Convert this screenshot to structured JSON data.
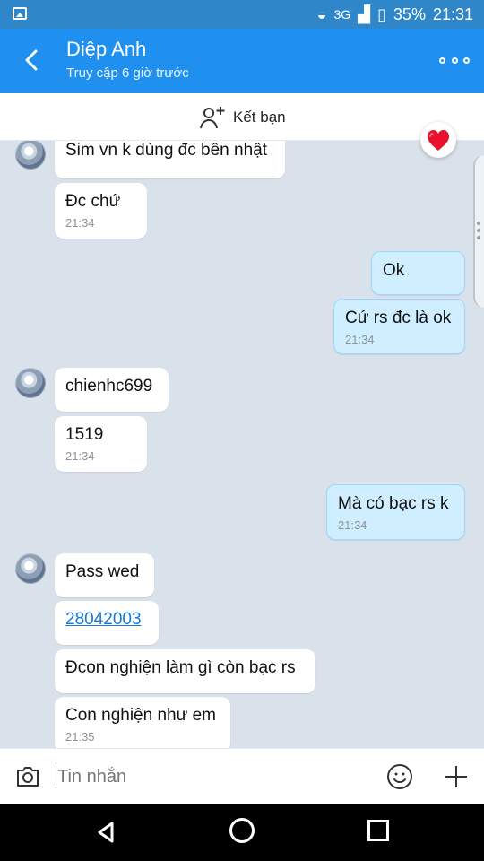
{
  "status": {
    "network": "3G",
    "battery": "35%",
    "time": "21:31"
  },
  "header": {
    "title": "Diệp Anh",
    "subtitle": "Truy cập 6 giờ trước"
  },
  "friend": {
    "label": "Kết bạn"
  },
  "messages": [
    {
      "side": "in",
      "text": "Sim vn k dùng đc bên nhật"
    },
    {
      "side": "in",
      "text": "Đc chứ",
      "time": "21:34"
    },
    {
      "side": "out",
      "text": "Ok"
    },
    {
      "side": "out",
      "text": "Cứ rs đc là ok",
      "time": "21:34"
    },
    {
      "side": "in",
      "text": "chienhc699"
    },
    {
      "side": "in",
      "text": "1519",
      "time": "21:34"
    },
    {
      "side": "out",
      "text": "Mà có bạc rs k",
      "time": "21:34"
    },
    {
      "side": "in",
      "text": "Pass wed"
    },
    {
      "side": "in",
      "text": "28042003"
    },
    {
      "side": "in",
      "text": "Đcon nghiện làm gì còn bạc rs"
    },
    {
      "side": "in",
      "text": "Con nghiện như em",
      "time": "21:35"
    }
  ],
  "composer": {
    "placeholder": "Tin nhắn"
  },
  "icons": {
    "back": "chevron-left-icon",
    "more": "more-icon",
    "add_friend": "add-user-icon",
    "heart": "heart-icon",
    "camera": "camera-icon",
    "emoji": "emoji-icon",
    "plus": "plus-icon"
  },
  "colors": {
    "header": "#1f8ff0",
    "outgoing": "#cfeeff",
    "link": "#1778d8"
  }
}
